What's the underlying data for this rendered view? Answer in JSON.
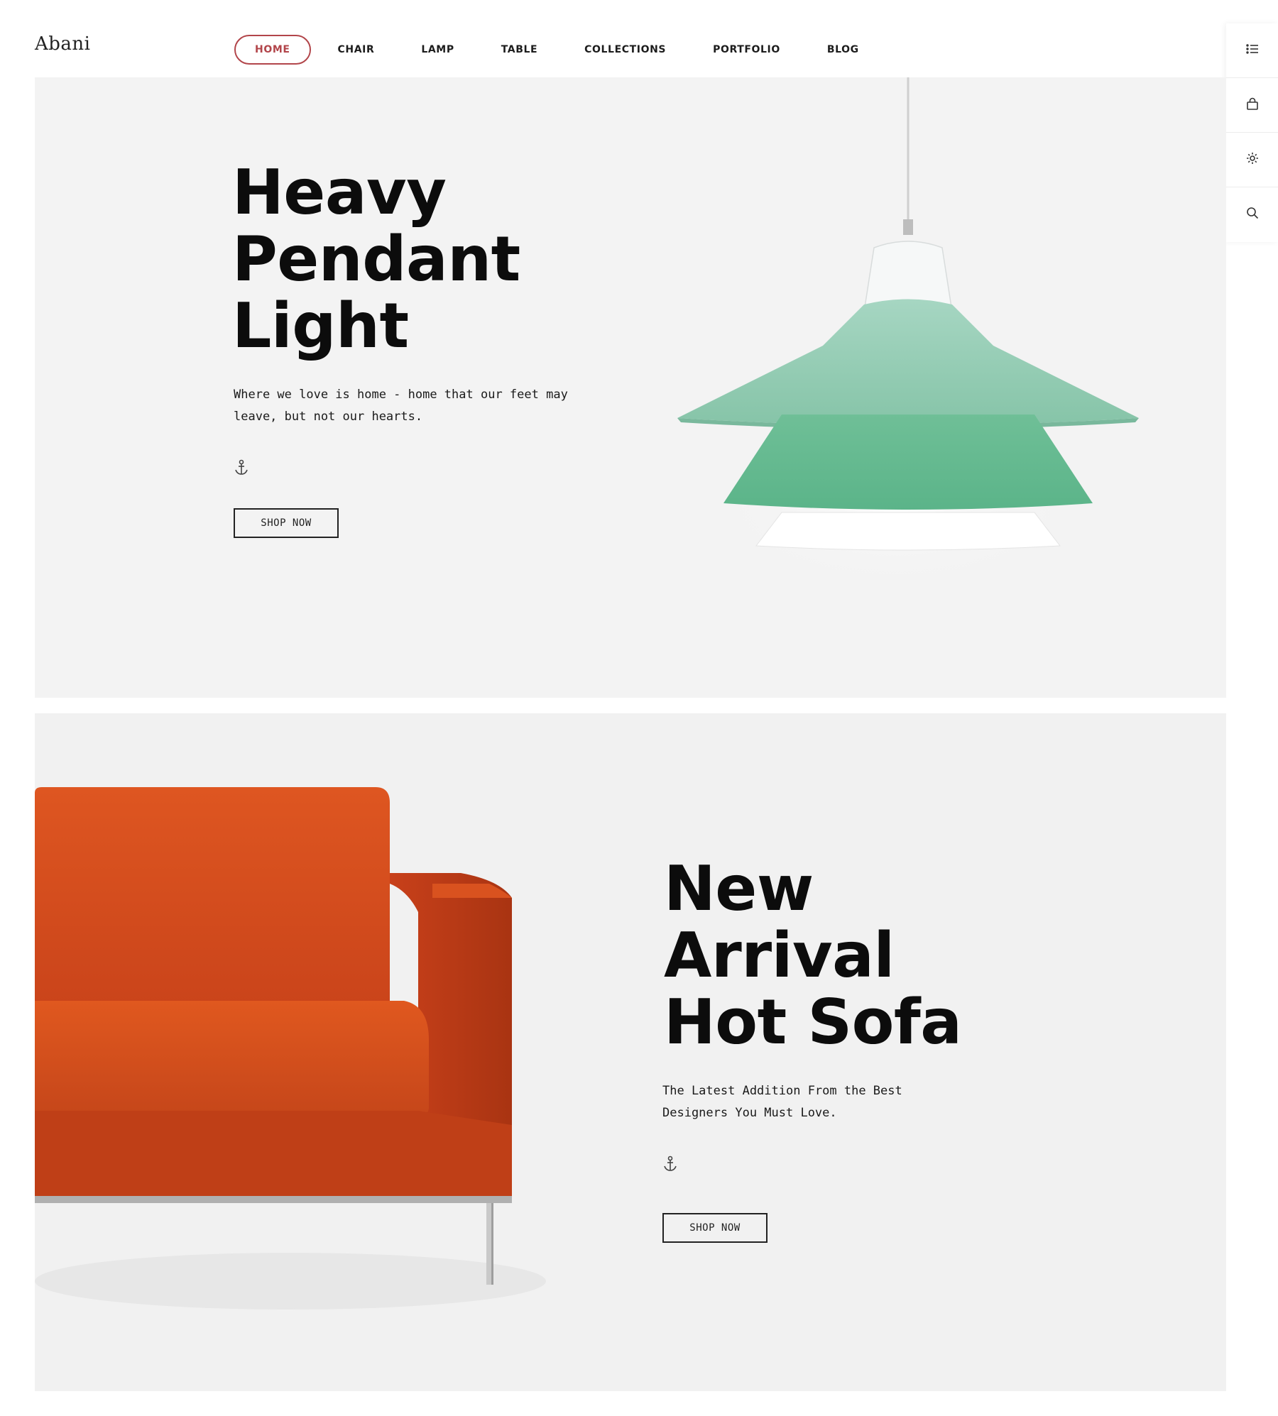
{
  "brand": {
    "logo": "Abani"
  },
  "nav": {
    "items": [
      {
        "label": "HOME",
        "active": true
      },
      {
        "label": "CHAIR"
      },
      {
        "label": "LAMP"
      },
      {
        "label": "TABLE"
      },
      {
        "label": "COLLECTIONS"
      },
      {
        "label": "PORTFOLIO"
      },
      {
        "label": "BLOG"
      }
    ]
  },
  "sidebar": {
    "icons": [
      "list-icon",
      "bag-icon",
      "gear-icon",
      "search-icon"
    ]
  },
  "hero1": {
    "title_lines": [
      "Heavy",
      "Pendant",
      "Light"
    ],
    "description": "Where we love is home - home that our feet may leave, but not our hearts.",
    "button": "SHOP NOW",
    "image": "pendant-lamp"
  },
  "hero2": {
    "title_lines": [
      "New",
      "Arrival",
      "Hot Sofa"
    ],
    "description": "The Latest Addition From  the Best Designers You Must Love.",
    "button": "SHOP NOW",
    "image": "orange-armchair"
  },
  "colors": {
    "accent": "#b2454a",
    "panel_bg": "#f3f3f3",
    "lamp_green": "#8ec9ad",
    "lamp_green_dark": "#63b88f",
    "sofa_orange": "#d24a1c"
  }
}
